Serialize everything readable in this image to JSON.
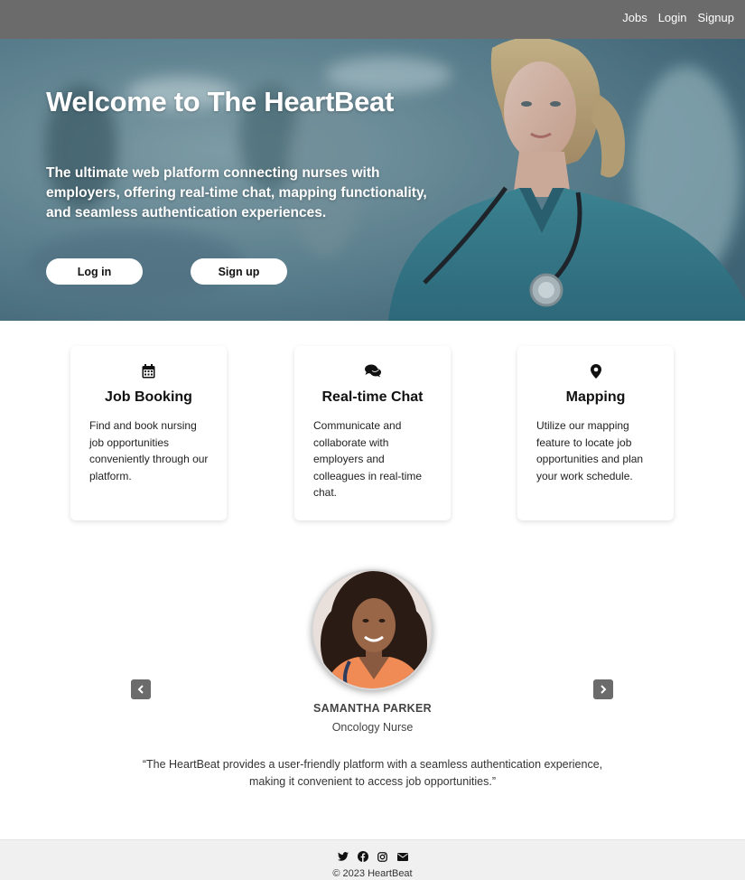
{
  "nav": {
    "links": [
      "Jobs",
      "Login",
      "Signup"
    ]
  },
  "hero": {
    "title": "Welcome to The HeartBeat",
    "subtitle": "The ultimate web platform connecting nurses with employers, offering real-time chat, mapping functionality, and seamless authentication experiences.",
    "login_label": "Log in",
    "signup_label": "Sign up"
  },
  "features": [
    {
      "icon": "calendar-icon",
      "title": "Job Booking",
      "text": "Find and book nursing job opportunities conveniently through our platform."
    },
    {
      "icon": "chat-icon",
      "title": "Real-time Chat",
      "text": "Communicate and collaborate with employers and colleagues in real-time chat."
    },
    {
      "icon": "map-pin-icon",
      "title": "Mapping",
      "text": "Utilize our mapping feature to locate job opportunities and plan your work schedule."
    }
  ],
  "testimonial": {
    "name": "SAMANTHA PARKER",
    "role": "Oncology Nurse",
    "quote": "“The HeartBeat provides a user-friendly platform with a seamless authentication experience, making it convenient to access job opportunities.”"
  },
  "footer": {
    "social_icons": [
      "twitter-icon",
      "facebook-icon",
      "instagram-icon",
      "envelope-icon"
    ],
    "copyright": "© 2023 HeartBeat"
  },
  "colors": {
    "navbar": "#6b6b6b",
    "hero_tint": "#6d95a2",
    "footer": "#f0f0f0",
    "button": "#ffffff"
  }
}
